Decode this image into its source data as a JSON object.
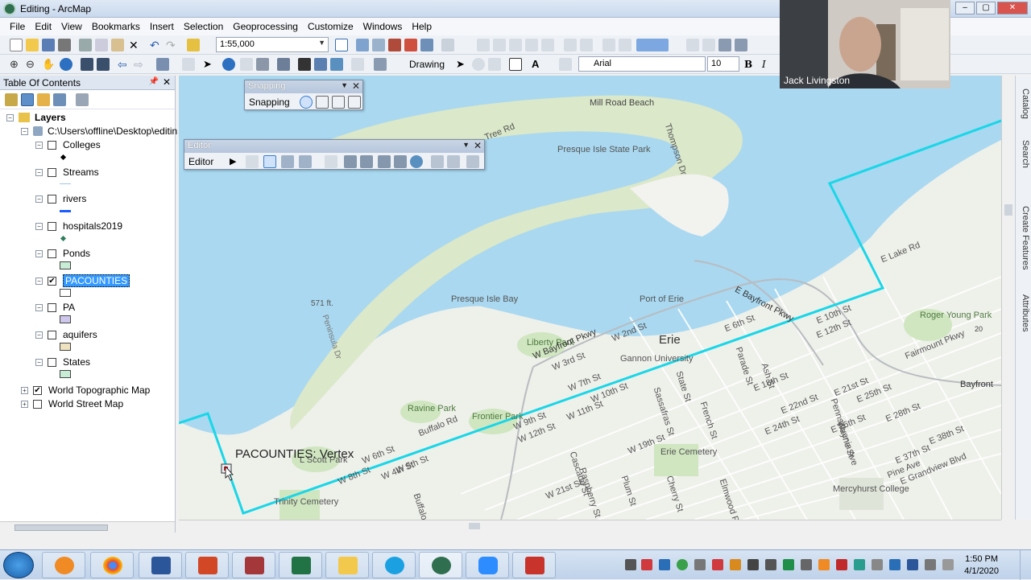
{
  "window": {
    "title": "Editing - ArcMap"
  },
  "menu": [
    "File",
    "Edit",
    "View",
    "Bookmarks",
    "Insert",
    "Selection",
    "Geoprocessing",
    "Customize",
    "Windows",
    "Help"
  ],
  "toolbar": {
    "scale": "1:55,000",
    "drawing_label": "Drawing",
    "font_name": "Arial",
    "font_size": "10",
    "bold_label": "B",
    "italic_label": "I"
  },
  "toc": {
    "title": "Table Of Contents",
    "root": "Layers",
    "datasource": "C:\\Users\\offline\\Desktop\\editin",
    "layers": [
      {
        "name": "Colleges",
        "checked": false,
        "symbol": "point",
        "color": "#000000"
      },
      {
        "name": "Streams",
        "checked": false,
        "symbol": "line",
        "color": "#9cc8e8"
      },
      {
        "name": "rivers",
        "checked": false,
        "symbol": "line",
        "color": "#1a5cff"
      },
      {
        "name": "hospitals2019",
        "checked": false,
        "symbol": "point",
        "color": "#2e7d5b"
      },
      {
        "name": "Ponds",
        "checked": false,
        "symbol": "polygon",
        "color": "#c8ecd5"
      },
      {
        "name": "PACOUNTIES",
        "checked": true,
        "symbol": "polygon",
        "color": "#ffffff",
        "selected": true
      },
      {
        "name": "PA",
        "checked": false,
        "symbol": "polygon",
        "color": "#d0c8ec"
      },
      {
        "name": "aquifers",
        "checked": false,
        "symbol": "polygon",
        "color": "#efe2c0"
      },
      {
        "name": "States",
        "checked": false,
        "symbol": "polygon",
        "color": "#c8ecd5"
      }
    ],
    "basemaps": [
      {
        "name": "World Topographic Map",
        "checked": true
      },
      {
        "name": "World Street Map",
        "checked": false
      }
    ]
  },
  "snapping": {
    "title": "Snapping",
    "menu_label": "Snapping"
  },
  "editor": {
    "title": "Editor",
    "menu_label": "Editor"
  },
  "map": {
    "snap_tip": "PACOUNTIES: Vertex",
    "labels": [
      "Mill Road Beach",
      "Presque Isle State Park",
      "Presque Isle Bay",
      "571 ft.",
      "Peninsula Dr",
      "Port of Erie",
      "Erie",
      "Liberty Park",
      "Gannon University",
      "W Bayfront Pkwy",
      "E Bayfront Pkwy",
      "Ravine Park",
      "Frontier Park",
      "L Scott Park",
      "Trinity Cemetery",
      "Erie Cemetery",
      "Mercyhurst College",
      "Roger Young Park",
      "Bayfront",
      "E Lake Rd",
      "E 10th St",
      "E 12th St",
      "E 6th St",
      "Parade St",
      "E 18th St",
      "E 21st St",
      "E 22nd St",
      "E 24th St",
      "E 25th St",
      "E 26th St",
      "E 28th St",
      "E 37th St",
      "E 38th St",
      "E Grandview Blvd",
      "Pine Ave",
      "W 2nd St",
      "W 3rd St",
      "W 7th St",
      "W 8th St",
      "W 9th St",
      "W 10th St",
      "W 11th St",
      "W 12th St",
      "W 19th St",
      "W 21st St",
      "W 6th St",
      "State St",
      "Sassafras St",
      "French St",
      "Ash St",
      "Cascade St",
      "Raspberry St",
      "Plum St",
      "Cherry St",
      "Elmwood Park Ave",
      "Fairmount Pkwy",
      "Tree Rd",
      "Thompson Dr",
      "Pennsylvania Ave",
      "Wayne St",
      "Buffalo Rd",
      "20",
      "W 5th St",
      "W 4th St",
      "Buffalo St"
    ]
  },
  "side_tabs": [
    "Catalog",
    "Search",
    "Create Features",
    "Attributes"
  ],
  "webcam": {
    "name": "Jack Livingston"
  },
  "clock": {
    "time": "1:50 PM",
    "date": "4/1/2020"
  },
  "colors": {
    "county_boundary": "#19d6e8",
    "water": "#a8d8f0",
    "land": "#eef0ea",
    "selection": "#3399ff"
  }
}
